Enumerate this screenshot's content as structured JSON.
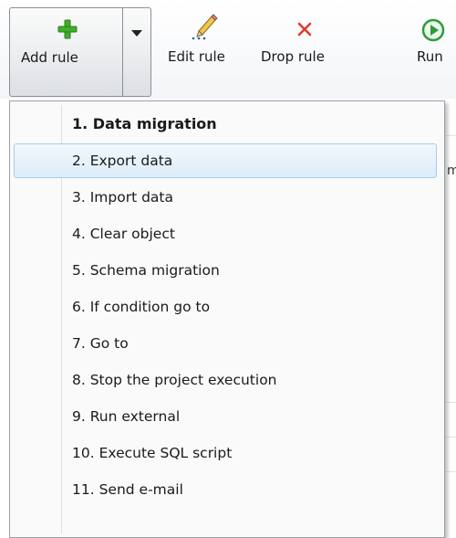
{
  "toolbar": {
    "add_rule_label": "Add rule",
    "edit_rule_label": "Edit rule",
    "drop_rule_label": "Drop rule",
    "run_label": "Run",
    "colors": {
      "add": "#3fae2a",
      "drop": "#e23b2e",
      "run": "#2e9a3a"
    }
  },
  "menu": {
    "items": [
      {
        "label": "1. Data migration"
      },
      {
        "label": "2. Export data"
      },
      {
        "label": "3. Import data"
      },
      {
        "label": "4. Clear object"
      },
      {
        "label": "5. Schema migration"
      },
      {
        "label": "6. If condition go to"
      },
      {
        "label": "7. Go to"
      },
      {
        "label": "8. Stop the project execution"
      },
      {
        "label": "9. Run external"
      },
      {
        "label": "10. Execute SQL script"
      },
      {
        "label": "11. Send e-mail"
      }
    ]
  },
  "background": {
    "partial_text": "m"
  }
}
